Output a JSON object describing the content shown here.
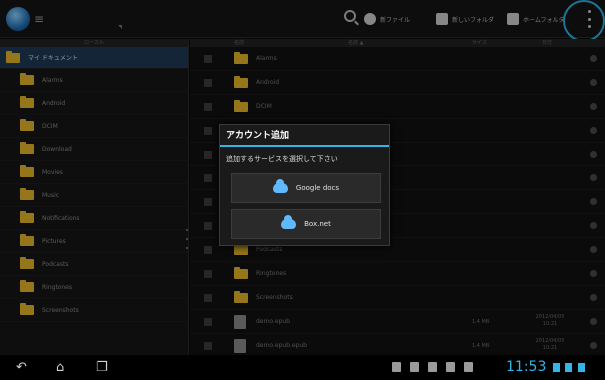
{
  "top_bar": {
    "menu_glyph": "≡",
    "actions": [
      {
        "label": "新ファイル",
        "icon": "gear-icon"
      },
      {
        "label": "新しいフォルダ",
        "icon": "file-icon"
      },
      {
        "label": "ホームフォルダ",
        "icon": "folder-icon"
      }
    ]
  },
  "tree": {
    "header": "ローカル",
    "root_label": "マイ ドキュメント",
    "items": [
      "Alarms",
      "Android",
      "DCIM",
      "Download",
      "Movies",
      "Music",
      "Notifications",
      "Pictures",
      "Podcasts",
      "Ringtones",
      "Screenshots"
    ]
  },
  "list": {
    "headers": [
      "名前",
      "名前 ▲",
      "サイズ",
      "日付"
    ],
    "rows": [
      {
        "type": "folder",
        "name": "Alarms",
        "size": "",
        "date": ""
      },
      {
        "type": "folder",
        "name": "Android",
        "size": "",
        "date": ""
      },
      {
        "type": "folder",
        "name": "DCIM",
        "size": "",
        "date": ""
      },
      {
        "type": "folder",
        "name": "",
        "size": "",
        "date": ""
      },
      {
        "type": "folder",
        "name": "",
        "size": "",
        "date": ""
      },
      {
        "type": "folder",
        "name": "",
        "size": "",
        "date": ""
      },
      {
        "type": "folder",
        "name": "",
        "size": "",
        "date": ""
      },
      {
        "type": "folder",
        "name": "",
        "size": "",
        "date": ""
      },
      {
        "type": "folder",
        "name": "Podcasts",
        "size": "",
        "date": ""
      },
      {
        "type": "folder",
        "name": "Ringtones",
        "size": "",
        "date": ""
      },
      {
        "type": "folder",
        "name": "Screenshots",
        "size": "",
        "date": ""
      },
      {
        "type": "file",
        "name": "demo.epub",
        "size": "1.4 MB",
        "date": "2012/04/05 10:21"
      },
      {
        "type": "file",
        "name": "demo.epub.epub",
        "size": "1.4 MB",
        "date": "2012/04/05 10:21"
      }
    ]
  },
  "dialog": {
    "title": "アカウント追加",
    "message": "追加するサービスを選択して下さい",
    "buttons": [
      {
        "label": "Google docs",
        "icon": "cloud-icon"
      },
      {
        "label": "Box.net",
        "icon": "box-icon"
      }
    ]
  },
  "system_bar": {
    "clock": "11:53",
    "nav": [
      "back-icon",
      "home-icon",
      "recent-apps-icon"
    ]
  },
  "colors": {
    "accent": "#33b5e5",
    "folder": "#e6b62a",
    "highlight": "#29b6e6"
  }
}
